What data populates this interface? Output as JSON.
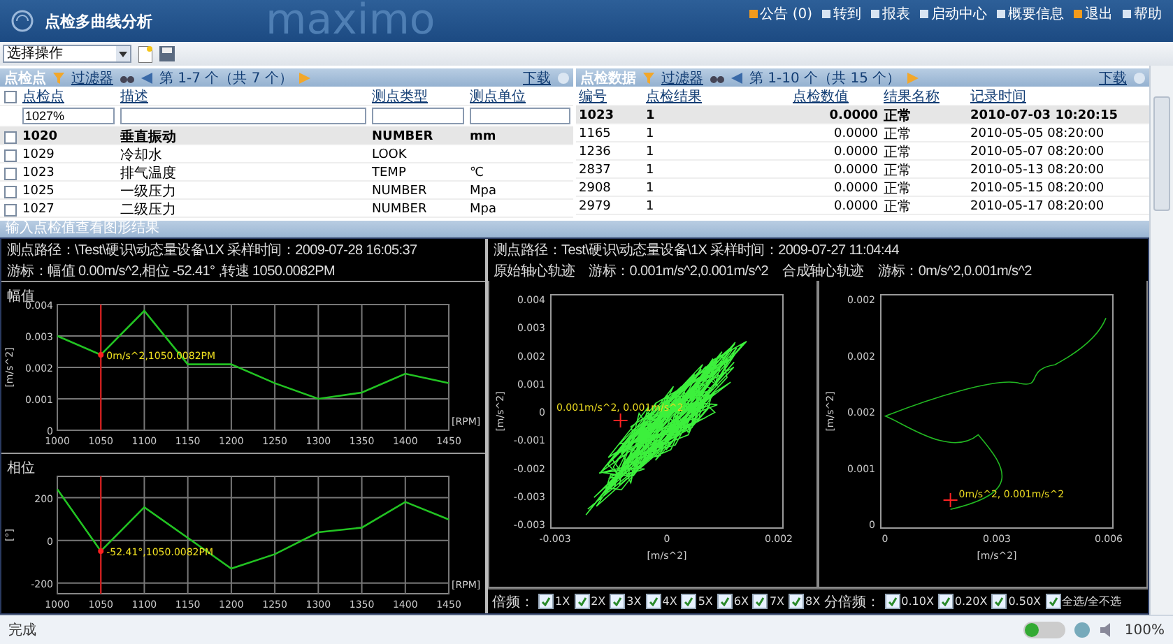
{
  "header": {
    "title": "点检多曲线分析",
    "brand": "maximo",
    "links": [
      {
        "label": "公告 (0)"
      },
      {
        "label": "转到"
      },
      {
        "label": "报表"
      },
      {
        "label": "启动中心"
      },
      {
        "label": "概要信息"
      },
      {
        "label": "退出"
      },
      {
        "label": "帮助"
      }
    ]
  },
  "toolbar": {
    "action_select": "选择操作"
  },
  "points_table": {
    "title": "点检点",
    "filter": "过滤器",
    "pager": "第 1-7 个（共 7 个）",
    "download": "下载",
    "columns": [
      "点检点",
      "描述",
      "测点类型",
      "测点单位"
    ],
    "select_all_checked": false,
    "filter_value": "1027%",
    "rows": [
      {
        "cells": [
          "1020",
          "垂直振动",
          "NUMBER",
          "mm"
        ],
        "selected": true,
        "checked": false
      },
      {
        "cells": [
          "1029",
          "冷却水",
          "LOOK",
          ""
        ],
        "selected": false,
        "checked": false
      },
      {
        "cells": [
          "1023",
          "排气温度",
          "TEMP",
          "℃"
        ],
        "selected": false,
        "checked": false
      },
      {
        "cells": [
          "1025",
          "一级压力",
          "NUMBER",
          "Mpa"
        ],
        "selected": false,
        "checked": false
      },
      {
        "cells": [
          "1027",
          "二级压力",
          "NUMBER",
          "Mpa"
        ],
        "selected": false,
        "checked": false
      }
    ]
  },
  "data_table": {
    "title": "点检数据",
    "filter": "过滤器",
    "pager": "第 1-10 个（共 15 个）",
    "download": "下载",
    "columns": [
      "编号",
      "点检结果",
      "点检数值",
      "结果名称",
      "记录时间"
    ],
    "rows": [
      {
        "cells": [
          "1023",
          "1",
          "0.0000",
          "正常",
          "2010-07-03 10:20:15"
        ],
        "selected": true
      },
      {
        "cells": [
          "1165",
          "1",
          "0.0000",
          "正常",
          "2010-05-05 08:20:00"
        ],
        "selected": false
      },
      {
        "cells": [
          "1236",
          "1",
          "0.0000",
          "正常",
          "2010-05-07 08:20:00"
        ],
        "selected": false
      },
      {
        "cells": [
          "2837",
          "1",
          "0.0000",
          "正常",
          "2010-05-13 08:20:00"
        ],
        "selected": false
      },
      {
        "cells": [
          "2908",
          "1",
          "0.0000",
          "正常",
          "2010-05-15 08:20:00"
        ],
        "selected": false
      },
      {
        "cells": [
          "2979",
          "1",
          "0.0000",
          "正常",
          "2010-05-17 08:20:00"
        ],
        "selected": false
      }
    ]
  },
  "section_title": "输入点检值查看图形结果",
  "bode_panel": {
    "info": [
      "测点路径：\\Test\\硬识\\动态量设备\\1X   采样时间：2009-07-28 16:05:37",
      "游标：幅值 0.00m/s^2,相位 -52.41° ,转速 1050.0082PM"
    ],
    "amplitude": {
      "chart_data": {
        "type": "line",
        "title": "幅值",
        "xlabel": "[RPM]",
        "ylabel": "[m/s^2]",
        "x": [
          1000,
          1050,
          1100,
          1150,
          1200,
          1250,
          1300,
          1350,
          1400,
          1450
        ],
        "grid": true,
        "ref_lines": [
          {
            "axis": "x",
            "value": 1050,
            "color": "#e01010"
          }
        ],
        "series": [
          {
            "color": "#22c322",
            "values": [
              0.003,
              0.0024,
              0.0038,
              0.0021,
              0.0021,
              0.0015,
              0.001,
              0.0012,
              0.0018,
              0.0015
            ]
          }
        ],
        "xlim": [
          1000,
          1450
        ],
        "ylim": [
          0,
          0.004
        ],
        "xticks": [
          1000,
          1050,
          1100,
          1150,
          1200,
          1250,
          1300,
          1350,
          1400,
          1450
        ],
        "yticks": [
          0,
          0.001,
          0.002,
          0.003,
          0.004
        ],
        "annotations": [
          {
            "x": 1050,
            "y": 0.0024,
            "text": "0m/s^2,1050.0082PM"
          }
        ]
      }
    },
    "phase": {
      "chart_data": {
        "type": "line",
        "title": "相位",
        "xlabel": "[RPM]",
        "ylabel": "[°]",
        "x": [
          1000,
          1050,
          1100,
          1150,
          1200,
          1250,
          1300,
          1350,
          1400,
          1450
        ],
        "grid": true,
        "ref_lines": [
          {
            "axis": "x",
            "value": 1050,
            "color": "#e01010"
          }
        ],
        "series": [
          {
            "color": "#22c322",
            "values": [
              240,
              -50,
              155,
              12,
              -132,
              -65,
              38,
              60,
              180,
              98
            ]
          }
        ],
        "xlim": [
          1000,
          1450
        ],
        "ylim": [
          -250,
          300
        ],
        "xticks": [
          1000,
          1050,
          1100,
          1150,
          1200,
          1250,
          1300,
          1350,
          1400,
          1450
        ],
        "yticks": [
          -200,
          0,
          200
        ],
        "annotations": [
          {
            "x": 1050,
            "y": -50,
            "text": "-52.41°,1050.0082PM"
          }
        ]
      }
    }
  },
  "orbit_panel": {
    "info": "测点路径：Test\\硬识\\动态量设备\\1X   采样时间：2009-07-27 11:04:44",
    "orbits": [
      {
        "kind": "raw",
        "title": "原始轴心轨迹",
        "cursor": "游标：0.001m/s^2,0.001m/s^2",
        "yticks": [
          "0.004",
          "0.003",
          "0.002",
          "0.001",
          "0",
          "-0.001",
          "-0.002",
          "-0.003",
          "-0.003"
        ],
        "xticks": [
          "-0.003",
          "0",
          "0.002"
        ],
        "ylabel": "[m/s^2]",
        "xlabel": "[m/s^2]",
        "annotation": "0.001m/s^2, 0.001m/s^2"
      },
      {
        "kind": "composite",
        "title": "合成轴心轨迹",
        "cursor": "游标：0m/s^2,0.001m/s^2",
        "yticks": [
          "0.002",
          "0.002",
          "0.002",
          "0.001",
          "0"
        ],
        "xticks": [
          "0",
          "0.003",
          "0.006"
        ],
        "ylabel": "[m/s^2]",
        "xlabel": "[m/s^2]",
        "annotation": "0m/s^2, 0.001m/s^2"
      }
    ],
    "harmonics_label": "倍频：",
    "harmonics": [
      {
        "label": "1X",
        "checked": true
      },
      {
        "label": "2X",
        "checked": true
      },
      {
        "label": "3X",
        "checked": true
      },
      {
        "label": "4X",
        "checked": true
      },
      {
        "label": "5X",
        "checked": true
      },
      {
        "label": "6X",
        "checked": true
      },
      {
        "label": "7X",
        "checked": true
      },
      {
        "label": "8X",
        "checked": true
      }
    ],
    "subharmonics_label": "分倍频：",
    "subharmonics": [
      {
        "label": "0.10X",
        "checked": true
      },
      {
        "label": "0.20X",
        "checked": true
      },
      {
        "label": "0.50X",
        "checked": true
      },
      {
        "label": "全选/全不选",
        "checked": true
      }
    ]
  },
  "status_bar": {
    "text": "完成",
    "zoom": "100%"
  }
}
